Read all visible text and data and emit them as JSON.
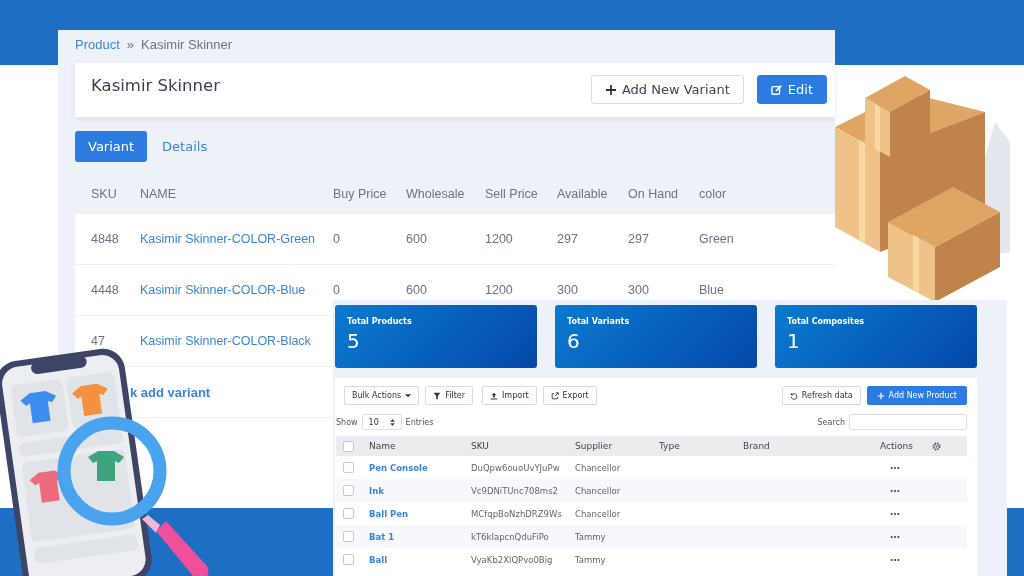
{
  "detail": {
    "breadcrumb": [
      {
        "kind": "link",
        "label": "Product"
      },
      {
        "kind": "separator",
        "label": "»"
      },
      {
        "kind": "current",
        "label": "Kasimir Skinner"
      }
    ],
    "title": "Kasimir Skinner",
    "buttons": [
      {
        "kind": "outline",
        "label": "Add New Variant"
      },
      {
        "kind": "primary",
        "label": "Edit"
      }
    ],
    "tabs": [
      {
        "label": "Variant",
        "selected": true
      },
      {
        "label": "Details",
        "selected": false
      }
    ],
    "table": {
      "columns": [
        "SKU",
        "NAME",
        "Buy Price",
        "Wholesale",
        "Sell Price",
        "Available",
        "On Hand",
        "color"
      ],
      "rows": [
        [
          "4848",
          "Kasimir Skinner-COLOR-Green",
          "0",
          "600",
          "1200",
          "297",
          "297",
          "Green"
        ],
        [
          "4448",
          "Kasimir Skinner-COLOR-Blue",
          "0",
          "600",
          "1200",
          "300",
          "300",
          "Blue"
        ],
        [
          "47",
          "Kasimir Skinner-COLOR-Black"
        ]
      ]
    },
    "quick_add": "k add variant"
  },
  "dashboard": {
    "stats": [
      {
        "label": "Total Products",
        "value": "5"
      },
      {
        "label": "Total Variants",
        "value": "6"
      },
      {
        "label": "Total Composites",
        "value": "1"
      }
    ],
    "toolbar": [
      {
        "kind": "dropdown",
        "label": "Bulk Actions"
      },
      {
        "kind": "filter",
        "label": "Filter"
      },
      {
        "kind": "import",
        "label": "Import"
      },
      {
        "kind": "export",
        "label": "Export"
      },
      {
        "kind": "refresh",
        "label": "Refresh data"
      },
      {
        "kind": "primary",
        "label": "Add New Product"
      }
    ],
    "show_label": "Show",
    "entries_value": "10",
    "entries_label": "Entries",
    "search_label": "Search",
    "table": {
      "all_checked": false,
      "columns": [
        "Name",
        "SKU",
        "Supplier",
        "Type",
        "Brand",
        "Actions"
      ],
      "rows": [
        {
          "name": "Pen Console",
          "sku": "DuQpw6ouoUvYJuPw",
          "supplier": "Chancellor",
          "checked": false
        },
        {
          "name": "Ink",
          "sku": "Vc9DNiTUnc708ms2",
          "supplier": "Chancellor",
          "checked": false
        },
        {
          "name": "Ball Pen",
          "sku": "MCfqpBoNzhDRZ9Ws",
          "supplier": "Chancellor",
          "checked": false
        },
        {
          "name": "Bat 1",
          "sku": "kT6kIapcnQduFiPo",
          "supplier": "Tammy",
          "checked": false
        },
        {
          "name": "Ball",
          "sku": "VyaKb2XlQPvo0Big",
          "supplier": "Tammy",
          "checked": false
        }
      ]
    }
  }
}
